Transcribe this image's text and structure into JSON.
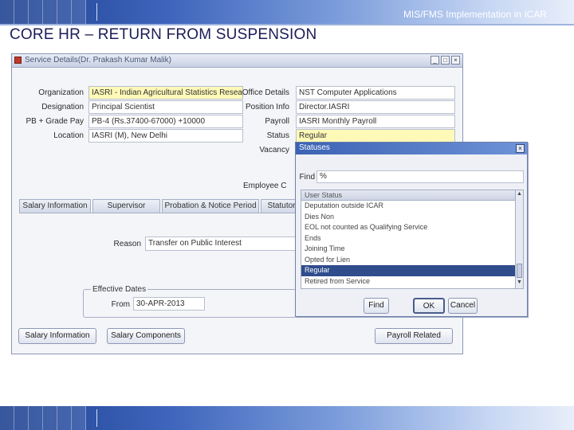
{
  "header_text": "MIS/FMS Implementation in ICAR",
  "slide_title": "CORE HR – RETURN FROM SUSPENSION",
  "window": {
    "title": "Service Details(Dr. Prakash Kumar Malik)",
    "controls": {
      "minimize": "_",
      "maximize": "□",
      "close": "×"
    }
  },
  "form": {
    "left": [
      {
        "label": "Organization",
        "value": "IASRI - Indian Agricultural Statistics Research",
        "highlight": true
      },
      {
        "label": "Designation",
        "value": "Principal Scientist",
        "highlight": false
      },
      {
        "label": "PB + Grade Pay",
        "value": "PB-4 (Rs.37400-67000) +10000",
        "highlight": false
      },
      {
        "label": "Location",
        "value": "IASRI (M), New Delhi",
        "highlight": false
      }
    ],
    "right": [
      {
        "label": "Office Details",
        "value": "NST Computer Applications",
        "highlight": false
      },
      {
        "label": "Position Info",
        "value": "Director.IASRI",
        "highlight": false
      },
      {
        "label": "Payroll",
        "value": "IASRI Monthly Payroll",
        "highlight": false
      },
      {
        "label": "Status",
        "value": "Regular",
        "highlight": true
      }
    ],
    "vacancy_label": "Vacancy",
    "employee_category_label": "Employee C",
    "tabs": [
      "Salary Information",
      "Supervisor",
      "Probation & Notice Period",
      "Statutory"
    ],
    "reason_label": "Reason",
    "reason_value": "Transfer on Public Interest",
    "effective_dates_title": "Effective Dates",
    "from_label": "From",
    "from_value": "30-APR-2013"
  },
  "buttons": {
    "salary_information": "Salary Information",
    "salary_components": "Salary Components",
    "payroll_related": "Payroll Related"
  },
  "lov": {
    "title": "Statuses",
    "find_label": "Find",
    "find_value": "%",
    "column_header": "User Status",
    "items": [
      "Deputation outside ICAR",
      "Dies Non",
      "EOL not counted as Qualifying Service",
      "Ends",
      "Joining Time",
      "Opted for Lien",
      "Regular",
      "Retired from Service"
    ],
    "selected": "Regular",
    "find_button": "Find",
    "ok_button": "OK",
    "cancel_button": "Cancel",
    "close": "×"
  },
  "colors": {
    "highlight_field": "#fff9b8",
    "selected_row": "#2f4c8c",
    "title_text": "#1c1c58"
  }
}
